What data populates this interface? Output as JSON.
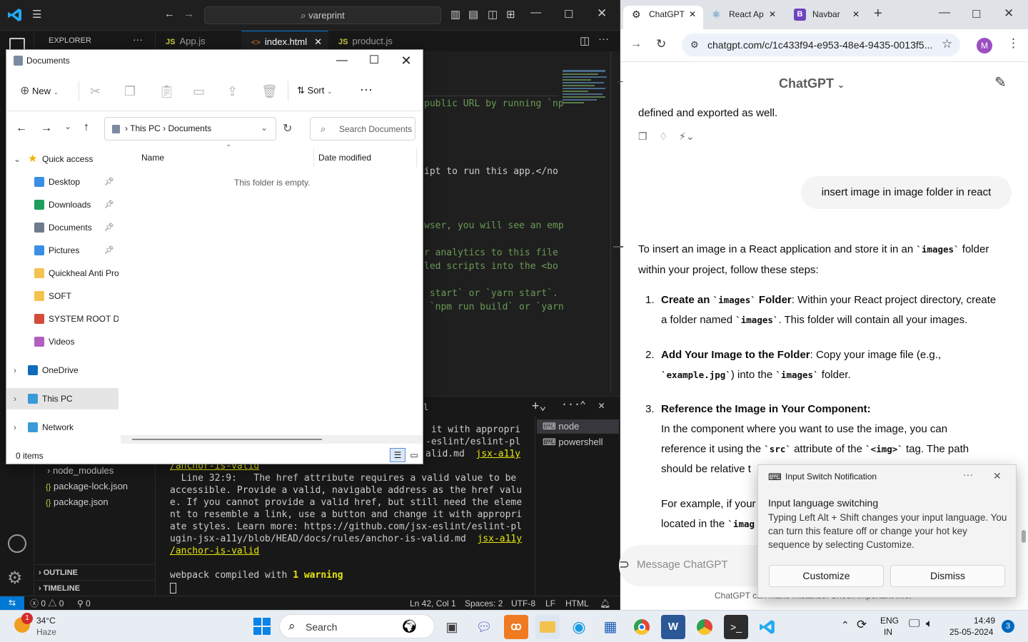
{
  "vscode": {
    "command_center": "vareprint",
    "sidebar_title": "EXPLORER",
    "tabs": [
      {
        "label": "App.js",
        "icon": "JS"
      },
      {
        "label": "index.html",
        "icon": "<>"
      },
      {
        "label": "product.js",
        "icon": "JS"
      }
    ],
    "tree": [
      {
        "label": "node_modules",
        "icon": "chevron-right"
      },
      {
        "label": "package-lock.json",
        "icon": "{}"
      },
      {
        "label": "package.json",
        "icon": "{}"
      }
    ],
    "outline_label": "OUTLINE",
    "timeline_label": "TIMELINE",
    "editor_lines": [
      "public URL by running `np",
      "ipt to run this app.</no",
      "wser, you will see an emp",
      "r analytics to this file",
      "led scripts into the <bo",
      " start` or `yarn start`.",
      " `npm run build` or `yarn"
    ],
    "terminal_lines_top": [
      " it with appropri",
      "-eslint/eslint-pl",
      "alid.md  jsx-a11y"
    ],
    "terminal_lines": [
      "/anchor-is-valid",
      "  Line 32:9:   The href attribute requires a valid value to be",
      "accessible. Provide a valid, navigable address as the href valu",
      "e. If you cannot provide a valid href, but still need the eleme",
      "nt to resemble a link, use a button and change it with appropri",
      "ate styles. Learn more: https://github.com/jsx-eslint/eslint-pl",
      "ugin-jsx-a11y/blob/HEAD/docs/rules/anchor-is-valid.md  jsx-a11y",
      "/anchor-is-valid",
      "",
      "webpack compiled with 1 warning"
    ],
    "terminal_link": "jsx-a11y",
    "terminal_warning": "1 warning",
    "terminal_sessions": [
      "node",
      "powershell"
    ],
    "terminal_tab_label": "l",
    "status": {
      "errors": "0",
      "warnings": "0",
      "ports": "0",
      "position": "Ln 42, Col 1",
      "spaces": "Spaces: 2",
      "encoding": "UTF-8",
      "eol": "LF",
      "language": "HTML"
    }
  },
  "explorer": {
    "title": "Documents",
    "new_label": "New",
    "sort_label": "Sort",
    "breadcrumb": [
      "This PC",
      "Documents"
    ],
    "search_placeholder": "Search Documents",
    "nav_items": [
      {
        "label": "Quick access",
        "icon": "star",
        "color": "#f0b400"
      },
      {
        "label": "Desktop",
        "icon": "desktop",
        "color": "#3a8ee6",
        "pinned": true
      },
      {
        "label": "Downloads",
        "icon": "download",
        "color": "#1e9e5a",
        "pinned": true
      },
      {
        "label": "Documents",
        "icon": "documents",
        "color": "#6d7b8d",
        "pinned": true
      },
      {
        "label": "Pictures",
        "icon": "pictures",
        "color": "#3a8ee6",
        "pinned": true
      },
      {
        "label": "Quickheal Anti Pro",
        "icon": "folder",
        "color": "#f3c34f"
      },
      {
        "label": "SOFT",
        "icon": "folder",
        "color": "#f3c34f"
      },
      {
        "label": "SYSTEM ROOT DAT",
        "icon": "system",
        "color": "#d24b3b"
      },
      {
        "label": "Videos",
        "icon": "videos",
        "color": "#b05fc1"
      },
      {
        "label": "OneDrive",
        "icon": "cloud",
        "color": "#0f6cbd"
      },
      {
        "label": "This PC",
        "icon": "pc",
        "color": "#3a9ad9"
      },
      {
        "label": "Network",
        "icon": "network",
        "color": "#3a9ad9"
      }
    ],
    "columns": [
      "Name",
      "Date modified"
    ],
    "empty_message": "This folder is empty.",
    "item_count": "0 items"
  },
  "chrome": {
    "tabs": [
      {
        "label": "ChatGPT",
        "icon": "chatgpt-icon"
      },
      {
        "label": "React Ap",
        "icon": "react-icon"
      },
      {
        "label": "Navbar",
        "icon": "bootstrap-icon"
      }
    ],
    "url": "chatgpt.com/c/1c433f94-e953-48e4-9435-0013f5...",
    "profile_initial": "M",
    "chat": {
      "model": "ChatGPT",
      "prev_text": "defined and exported as well.",
      "user_message": "insert image in image folder in react",
      "intro_a": "To insert an image in a React application and store it in an ",
      "intro_code": "`images`",
      "intro_b": " folder",
      "intro_c": "within your project, follow these steps:",
      "steps": [
        {
          "num": "1.",
          "title": "Create an ",
          "title_code": "`images`",
          "title_end": " Folder",
          "text_a": ": Within your React project directory, create",
          "text_b": "a folder named ",
          "text_code": "`images`",
          "text_c": ". This folder will contain all your images."
        },
        {
          "num": "2.",
          "title": "Add Your Image to the Folder",
          "text_a": ": Copy your image file (e.g.,",
          "text_code": "`example.jpg`",
          "text_b": ") into the ",
          "text_code2": "`images`",
          "text_c": " folder."
        },
        {
          "num": "3.",
          "title": "Reference the Image in Your Component",
          "text_a": "In the component where you want to use the image, you can",
          "text_b": "reference it using the ",
          "text_code": "`src`",
          "text_c": " attribute of the ",
          "text_code2": "`<img>`",
          "text_d": " tag. The path",
          "text_e": "should be relative t"
        }
      ],
      "example_a": "For example, if your",
      "example_b": "located in the ",
      "example_code": "`imag",
      "input_placeholder": "Message ChatGPT",
      "footer": "ChatGPT can make mistakes. Check important info."
    }
  },
  "notification": {
    "app": "Input Switch Notification",
    "title": "Input language switching",
    "body": "Typing Left Alt + Shift changes your input language. You can turn this feature off or change your hot key sequence by selecting Customize.",
    "customize": "Customize",
    "dismiss": "Dismiss"
  },
  "taskbar": {
    "weather_temp": "34°C",
    "weather_desc": "Haze",
    "weather_badge": "1",
    "search_label": "Search",
    "lang_a": "ENG",
    "lang_b": "IN",
    "time": "14:49",
    "date": "25-05-2024",
    "notif_count": "3",
    "apps": [
      {
        "name": "file-explorer",
        "color": "#f3c34f"
      },
      {
        "name": "edge",
        "color": "#1b9de2"
      },
      {
        "name": "store",
        "color": "#1c5fb8"
      },
      {
        "name": "chrome",
        "color": "#e2463a"
      },
      {
        "name": "word",
        "color": "#2b5797"
      },
      {
        "name": "chrome-profile",
        "color": "#e2463a"
      },
      {
        "name": "terminal",
        "color": "#2d2d2d"
      },
      {
        "name": "vscode",
        "color": "#23a9f2"
      }
    ]
  }
}
